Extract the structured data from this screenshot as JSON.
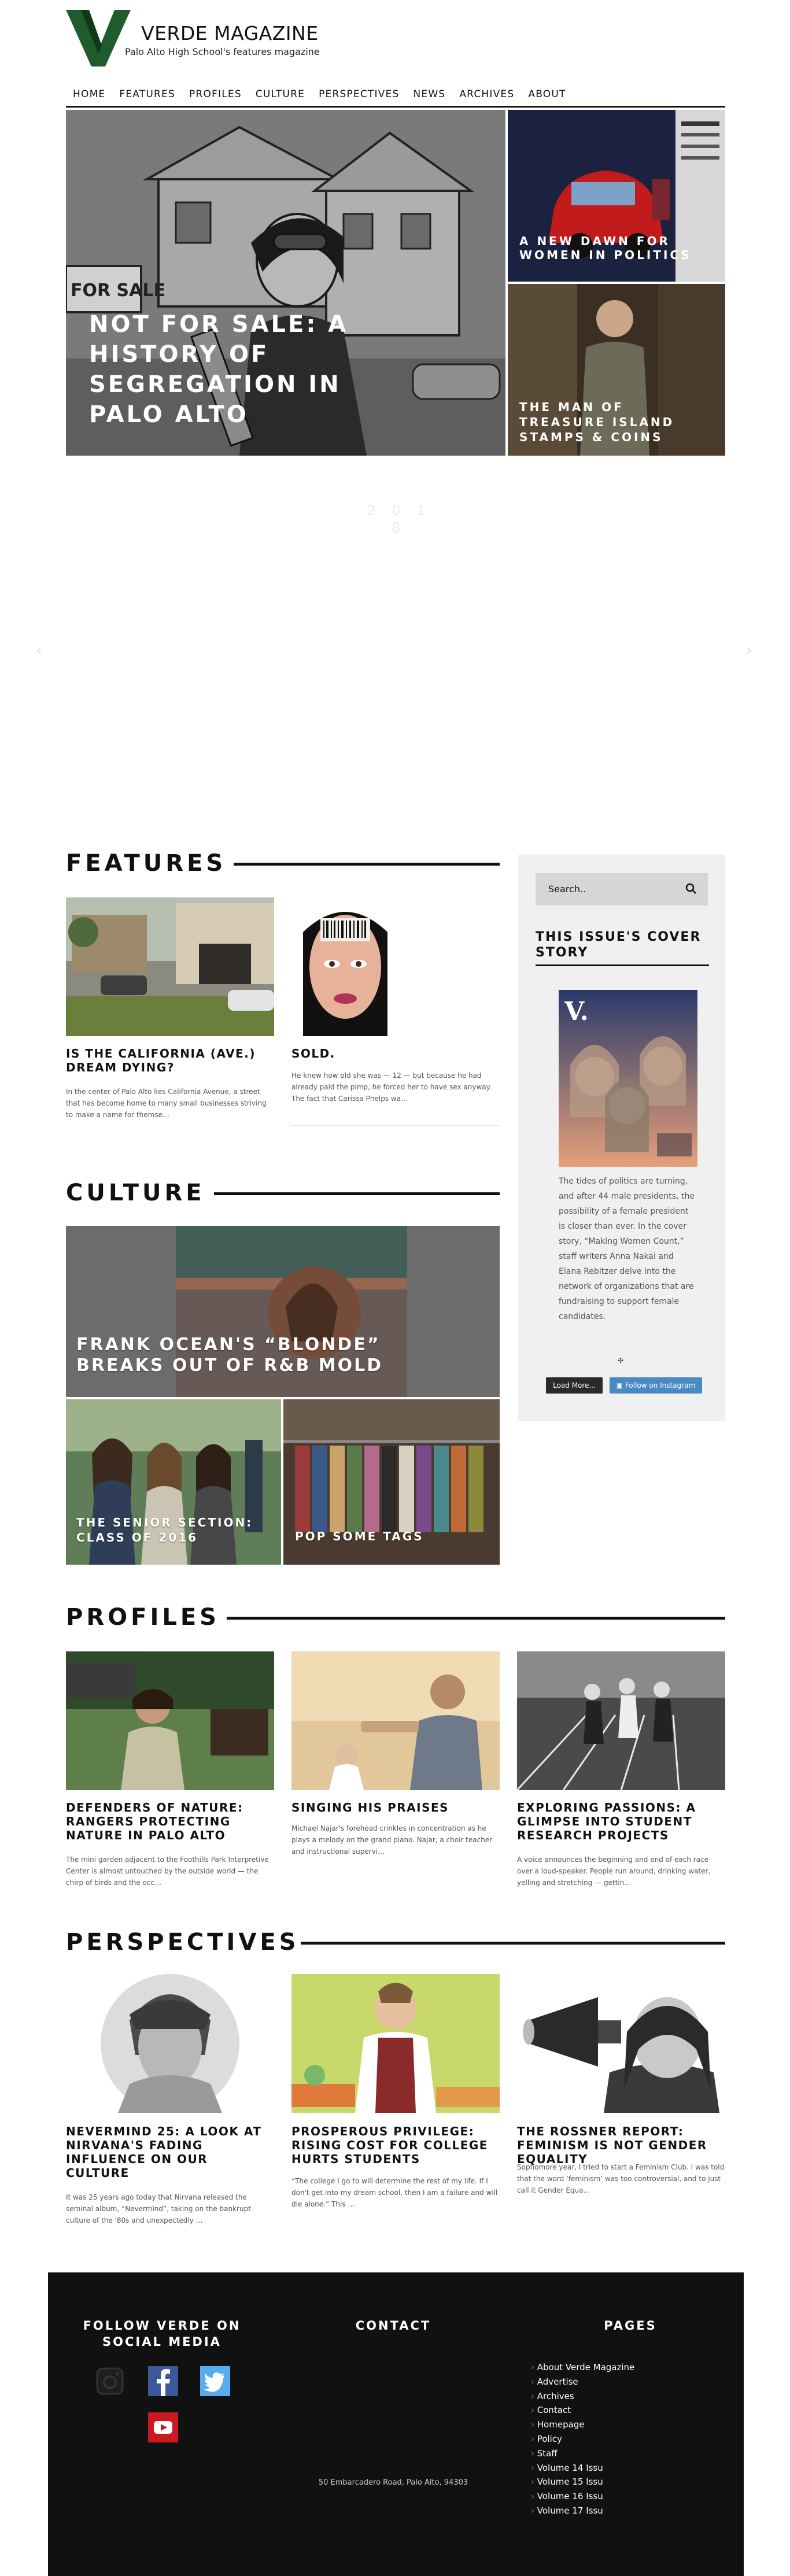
{
  "site": {
    "title": "VERDE MAGAZINE",
    "tagline": "Palo Alto High School's features magazine",
    "brand_color": "#1f5b2c"
  },
  "nav": [
    "HOME",
    "FEATURES",
    "PROFILES",
    "CULTURE",
    "PERSPECTIVES",
    "NEWS",
    "ARCHIVES",
    "ABOUT"
  ],
  "hero": {
    "main_title": "NOT FOR SALE: A HISTORY OF SEGREGATION IN PALO ALTO",
    "main_sign_text": "FOR SALE",
    "side": [
      {
        "title": "A NEW DAWN FOR WOMEN IN POLITICS"
      },
      {
        "title": "THE MAN OF TREASURE ISLAND STAMPS & COINS"
      }
    ],
    "dots_text": "2 0 1 8",
    "prev_arrow": "‹",
    "next_arrow": "›"
  },
  "features": {
    "heading": "FEATURES",
    "cards": [
      {
        "title": "IS THE CALIFORNIA (AVE.) DREAM DYING?",
        "excerpt": "In the center of Palo Alto lies California Avenue, a street that has become home to many small businesses striving to make a name for themse…"
      },
      {
        "title": "SOLD.",
        "excerpt": "He knew how old she was — 12 — but because he had already paid the pimp, he forced her to have sex anyway. The fact that Carissa Phelps wa…"
      }
    ]
  },
  "culture": {
    "heading": "CULTURE",
    "big": {
      "title": "FRANK OCEAN'S “BLONDE” BREAKS OUT OF R&B MOLD"
    },
    "small": [
      {
        "title": "THE SENIOR SECTION: CLASS OF 2016"
      },
      {
        "title": "POP SOME TAGS"
      }
    ]
  },
  "profiles": {
    "heading": "PROFILES",
    "cards": [
      {
        "title": "DEFENDERS OF NATURE: RANGERS PROTECTING NATURE IN PALO ALTO",
        "excerpt": "The mini garden adjacent to the Foothills Park Interpretive Center is almost untouched by the outside world — the chirp of birds and the occ…"
      },
      {
        "title": "SINGING HIS PRAISES",
        "excerpt": "Michael Najar's forehead crinkles in concentration as he plays a melody on the grand piano. Najar, a choir teacher and instructional supervi…"
      },
      {
        "title": "EXPLORING PASSIONS: A GLIMPSE INTO STUDENT RESEARCH PROJECTS",
        "excerpt": "A voice announces the beginning and end of each race over a loud-speaker. People run around, drinking water, yelling and stretching — gettin…"
      }
    ]
  },
  "perspectives": {
    "heading": "PERSPECTIVES",
    "cards": [
      {
        "title": "NEVERMIND 25: A LOOK AT NIRVANA'S FADING INFLUENCE ON OUR CULTURE",
        "excerpt": "It was 25 years ago today that Nirvana released the seminal album, “Nevermind”, taking on the bankrupt culture of the '80s and unexpectedly …"
      },
      {
        "title": "PROSPEROUS PRIVILEGE: RISING COST FOR COLLEGE HURTS STUDENTS",
        "excerpt": "“The college I go to will determine the rest of my life. If I don't get into my dream school, then I am a failure and will die alone.” This …"
      },
      {
        "title": "THE ROSSNER REPORT: FEMINISM IS NOT GENDER EQUALITY",
        "excerpt": "Sophomore year, I tried to start a Feminism Club. I was told that the word ‘feminism’ was too controversial, and to just call it Gender Equa…"
      }
    ]
  },
  "sidebar": {
    "search_placeholder": "Search..",
    "cover_heading": "THIS ISSUE'S COVER STORY",
    "cover_v": "V.",
    "cover_text": "The tides of politics are turning, and after 44 male presidents, the possibility of a female president is closer than ever. In the cover story, “Making Women Count,” staff writers Anna Nakai and Elana Rebitzer delve into the network of organizations that are fundraising to support female candidates.",
    "load_more": "Load More...",
    "follow_instagram": "Follow on Instagram"
  },
  "footer": {
    "social_heading": "FOLLOW VERDE ON SOCIAL MEDIA",
    "contact_heading": "CONTACT",
    "pages_heading": "PAGES",
    "address": "50 Embarcadero Road, Palo Alto, 94303",
    "pages": [
      "About Verde Magazine",
      "Advertise",
      "Archives",
      "Contact",
      "Homepage",
      "Policy",
      "Staff",
      "Volume 14 Issu",
      "Volume 15 Issu",
      "Volume 16 Issu",
      "Volume 17 Issu"
    ],
    "social_icons": [
      "instagram-icon",
      "facebook-icon",
      "twitter-icon",
      "youtube-icon"
    ],
    "social_colors": {
      "facebook": "#3b5998",
      "twitter": "#55acee",
      "youtube": "#cc181e"
    }
  }
}
